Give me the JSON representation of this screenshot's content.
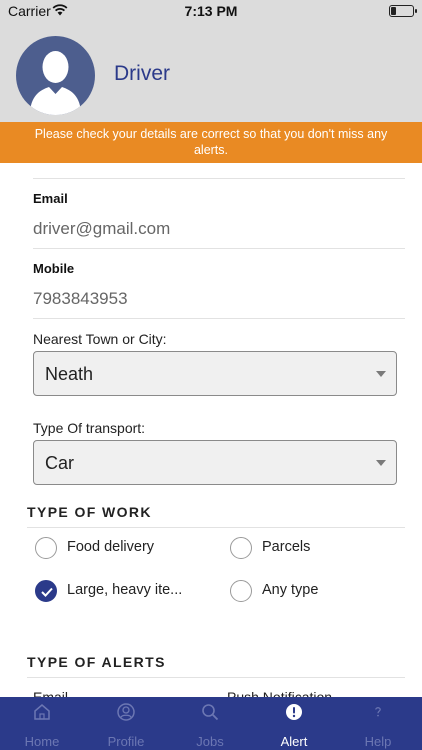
{
  "status_bar": {
    "carrier": "Carrier",
    "time": "7:13 PM"
  },
  "header": {
    "name": "Driver"
  },
  "notice": {
    "text": "Please check your details are correct so that you don't miss any alerts."
  },
  "form": {
    "email_label": "Email",
    "email_value": "driver@gmail.com",
    "mobile_label": "Mobile",
    "mobile_value": "7983843953",
    "town_label": "Nearest Town or City:",
    "town_value": "Neath",
    "transport_label": "Type Of transport:",
    "transport_value": "Car"
  },
  "type_of_work": {
    "title": "TYPE OF WORK",
    "options": [
      {
        "label": "Food delivery",
        "checked": false
      },
      {
        "label": "Parcels",
        "checked": false
      },
      {
        "label": "Large, heavy ite...",
        "checked": true
      },
      {
        "label": "Any type",
        "checked": false
      }
    ]
  },
  "type_of_alerts": {
    "title": "TYPE OF ALERTS",
    "option_left": "Email",
    "option_right": "Push Notification"
  },
  "tabs": [
    {
      "label": "Home",
      "icon": "home-icon",
      "active": false
    },
    {
      "label": "Profile",
      "icon": "profile-icon",
      "active": false
    },
    {
      "label": "Jobs",
      "icon": "search-icon",
      "active": false
    },
    {
      "label": "Alert",
      "icon": "alert-icon",
      "active": true
    },
    {
      "label": "Help",
      "icon": "help-icon",
      "active": false
    }
  ],
  "colors": {
    "brand": "#2b3a8a",
    "notice": "#e98a23",
    "header_bg": "#dcdcdc"
  }
}
